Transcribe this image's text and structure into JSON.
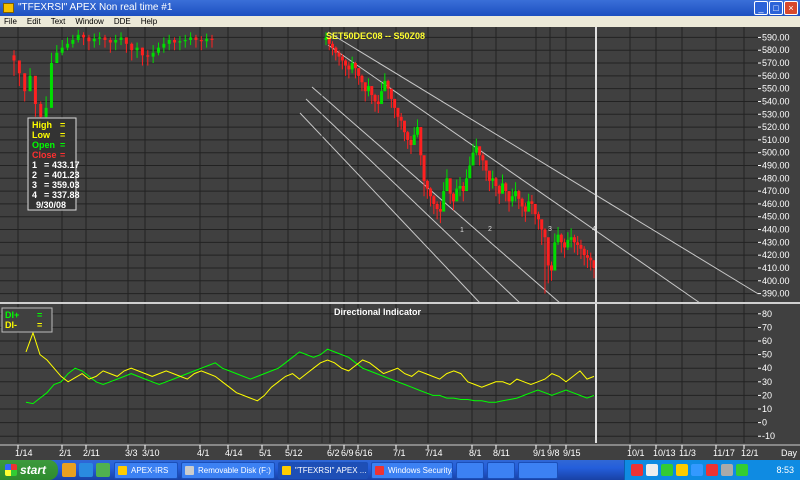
{
  "window": {
    "title": "\"TFEXRSI\" APEX Non real time #1",
    "menu": [
      "File",
      "Edit",
      "Text",
      "Window",
      "DDE",
      "Help"
    ]
  },
  "chart": {
    "symbol_label": "SET50DEC08 -- S50Z08",
    "price_ticks": [
      590,
      580,
      570,
      560,
      550,
      540,
      530,
      520,
      510,
      500,
      490,
      480,
      470,
      460,
      450,
      440,
      430,
      420,
      410,
      400,
      390
    ],
    "price_tick_labels": [
      "590.00",
      "580.00",
      "570.00",
      "560.00",
      "550.00",
      "540.00",
      "530.00",
      "520.00",
      "510.00",
      "500.00",
      "490.00",
      "480.00",
      "470.00",
      "460.00",
      "450.00",
      "440.00",
      "430.00",
      "420.00",
      "410.00",
      "400.00",
      "390.00"
    ],
    "info_box": {
      "rows": [
        {
          "label": "High",
          "eq": "=",
          "value": "",
          "color": "#ffff00"
        },
        {
          "label": "Low",
          "eq": "=",
          "value": "",
          "color": "#ffff00"
        },
        {
          "label": "Open",
          "eq": "=",
          "value": "",
          "color": "#00ff00"
        },
        {
          "label": "Close",
          "eq": "=",
          "value": "",
          "color": "#ff3030"
        },
        {
          "label": "1",
          "eq": "=",
          "value": "433.17",
          "color": "#ffffff"
        },
        {
          "label": "2",
          "eq": "=",
          "value": "401.23",
          "color": "#ffffff"
        },
        {
          "label": "3",
          "eq": "=",
          "value": "359.03",
          "color": "#ffffff"
        },
        {
          "label": "4",
          "eq": "=",
          "value": "337.88",
          "color": "#ffffff"
        }
      ],
      "date": "9/30/08"
    },
    "channel_labels": [
      "1",
      "2",
      "3",
      "4"
    ],
    "indicator": {
      "title": "Directional Indicator",
      "legend": [
        {
          "label": "DI+",
          "eq": "=",
          "color": "#00ff00"
        },
        {
          "label": "DI-",
          "eq": "=",
          "color": "#ffff00"
        }
      ],
      "ticks": [
        80,
        70,
        60,
        50,
        40,
        30,
        20,
        10,
        0,
        -10
      ],
      "tick_labels": [
        "80",
        "70",
        "60",
        "50",
        "40",
        "30",
        "20",
        "10",
        "0",
        "-10"
      ]
    },
    "date_labels": [
      "1/14",
      "2/1",
      "2/11",
      "3/3",
      "3/10",
      "4/1",
      "4/14",
      "5/1",
      "5/12",
      "6/2",
      "6/9",
      "6/16",
      "7/1",
      "7/14",
      "8/1",
      "8/11",
      "9/1",
      "9/8",
      "9/15",
      "10/1",
      "10/13",
      "11/3",
      "11/17",
      "12/1"
    ],
    "x_axis_unit": "Day"
  },
  "chart_data": [
    {
      "type": "candlestick",
      "title": "SET50DEC08 -- S50Z08",
      "ylim": [
        385,
        595
      ],
      "x": [
        "1/14",
        "1/16",
        "1/18",
        "1/22",
        "1/24",
        "1/28",
        "1/30",
        "2/1",
        "2/4",
        "2/6",
        "2/8",
        "2/11",
        "2/13",
        "2/15",
        "2/18",
        "2/20",
        "2/22",
        "2/25",
        "2/27",
        "2/29",
        "3/3",
        "3/5",
        "3/7",
        "3/10",
        "3/12",
        "3/14",
        "3/17",
        "3/19",
        "3/21",
        "3/24",
        "3/26",
        "3/28",
        "3/31",
        "4/1",
        "4/3",
        "4/7",
        "4/9",
        "4/11",
        "6/2",
        "6/3",
        "6/4",
        "6/5",
        "6/6",
        "6/9",
        "6/10",
        "6/11",
        "6/12",
        "6/13",
        "6/16",
        "6/17",
        "6/18",
        "6/19",
        "6/20",
        "6/23",
        "6/24",
        "6/25",
        "6/26",
        "6/27",
        "6/30",
        "7/1",
        "7/2",
        "7/3",
        "7/4",
        "7/7",
        "7/8",
        "7/9",
        "7/10",
        "7/11",
        "7/14",
        "7/15",
        "7/16",
        "7/18",
        "7/21",
        "7/22",
        "7/23",
        "7/24",
        "7/25",
        "7/28",
        "7/29",
        "7/30",
        "7/31",
        "8/1",
        "8/4",
        "8/5",
        "8/6",
        "8/7",
        "8/8",
        "8/11",
        "8/13",
        "8/14",
        "8/15",
        "8/18",
        "8/19",
        "8/20",
        "8/21",
        "8/22",
        "8/25",
        "8/26",
        "8/27",
        "8/28",
        "8/29",
        "9/1",
        "9/2",
        "9/3",
        "9/4",
        "9/5",
        "9/8",
        "9/9",
        "9/10",
        "9/11",
        "9/12",
        "9/15",
        "9/16",
        "9/17",
        "9/18",
        "9/19",
        "9/22",
        "9/23",
        "9/24",
        "9/25",
        "9/26",
        "9/29",
        "9/30"
      ],
      "close": [
        572,
        562,
        548,
        560,
        538,
        528,
        535,
        570,
        578,
        582,
        585,
        588,
        592,
        590,
        587,
        589,
        590,
        588,
        586,
        588,
        590,
        585,
        580,
        582,
        576,
        575,
        578,
        582,
        585,
        588,
        586,
        587,
        588,
        590,
        588,
        587,
        589,
        588,
        590,
        585,
        582,
        578,
        575,
        572,
        568,
        565,
        570,
        566,
        560,
        555,
        548,
        552,
        545,
        540,
        538,
        548,
        556,
        550,
        542,
        535,
        528,
        525,
        516,
        510,
        506,
        514,
        520,
        498,
        478,
        472,
        466,
        460,
        456,
        454,
        470,
        480,
        468,
        462,
        472,
        474,
        470,
        480,
        490,
        500,
        505,
        498,
        494,
        486,
        478,
        480,
        474,
        468,
        476,
        470,
        462,
        466,
        470,
        464,
        458,
        454,
        462,
        460,
        452,
        448,
        440,
        434,
        412,
        408,
        430,
        436,
        430,
        426,
        432,
        434,
        430,
        428,
        425,
        420,
        418,
        416,
        410
      ],
      "high": [
        580,
        572,
        562,
        566,
        548,
        540,
        544,
        578,
        584,
        588,
        590,
        592,
        596,
        594,
        592,
        593,
        594,
        592,
        590,
        592,
        594,
        590,
        586,
        586,
        582,
        580,
        584,
        586,
        590,
        592,
        590,
        591,
        592,
        594,
        592,
        591,
        593,
        592,
        594,
        590,
        587,
        583,
        580,
        577,
        573,
        571,
        575,
        571,
        566,
        561,
        554,
        558,
        552,
        546,
        545,
        555,
        562,
        557,
        549,
        542,
        535,
        531,
        523,
        517,
        513,
        520,
        526,
        505,
        486,
        479,
        473,
        467,
        462,
        462,
        477,
        487,
        475,
        469,
        479,
        481,
        477,
        487,
        497,
        507,
        511,
        505,
        500,
        493,
        485,
        486,
        481,
        475,
        483,
        477,
        469,
        472,
        477,
        471,
        465,
        461,
        468,
        467,
        459,
        454,
        447,
        441,
        420,
        415,
        437,
        442,
        437,
        433,
        438,
        441,
        436,
        435,
        432,
        427,
        424,
        422,
        416
      ],
      "low": [
        560,
        552,
        540,
        548,
        528,
        520,
        526,
        558,
        570,
        576,
        580,
        582,
        586,
        584,
        580,
        582,
        584,
        582,
        578,
        580,
        584,
        578,
        572,
        574,
        568,
        568,
        570,
        576,
        578,
        580,
        580,
        580,
        582,
        584,
        582,
        580,
        582,
        582,
        584,
        580,
        576,
        572,
        568,
        565,
        560,
        558,
        562,
        558,
        553,
        548,
        540,
        544,
        538,
        532,
        531,
        540,
        548,
        542,
        535,
        527,
        520,
        518,
        509,
        503,
        499,
        506,
        512,
        490,
        466,
        464,
        458,
        452,
        448,
        445,
        462,
        472,
        460,
        455,
        464,
        466,
        462,
        472,
        482,
        492,
        498,
        490,
        486,
        478,
        470,
        472,
        466,
        460,
        468,
        462,
        454,
        458,
        462,
        456,
        450,
        446,
        454,
        452,
        444,
        440,
        428,
        390,
        398,
        400,
        422,
        428,
        422,
        418,
        424,
        426,
        422,
        420,
        417,
        412,
        410,
        408,
        402
      ]
    },
    {
      "type": "line",
      "title": "Directional Indicator",
      "ylim": [
        -15,
        85
      ],
      "x_range": [
        "1/14",
        "9/30"
      ],
      "series": [
        {
          "name": "DI+",
          "color": "#00ff00",
          "values": [
            15,
            14,
            18,
            22,
            28,
            30,
            36,
            40,
            38,
            34,
            30,
            28,
            30,
            32,
            34,
            36,
            34,
            32,
            30,
            28,
            30,
            32,
            34,
            36,
            38,
            40,
            42,
            44,
            40,
            38,
            36,
            34,
            32,
            34,
            36,
            38,
            40,
            44,
            48,
            52,
            50,
            48,
            50,
            54,
            52,
            50,
            48,
            44,
            40,
            38,
            36,
            34,
            32,
            30,
            28,
            26,
            24,
            22,
            20,
            20,
            18,
            18,
            17,
            17,
            16,
            16,
            15,
            15,
            16,
            17,
            18,
            20,
            22,
            24,
            22,
            20,
            22,
            24,
            22,
            20,
            18,
            20
          ]
        },
        {
          "name": "DI-",
          "color": "#ffff00",
          "values": [
            52,
            66,
            50,
            46,
            40,
            34,
            30,
            33,
            36,
            32,
            34,
            38,
            36,
            34,
            38,
            40,
            38,
            36,
            34,
            36,
            38,
            36,
            34,
            32,
            36,
            38,
            36,
            34,
            30,
            26,
            22,
            20,
            18,
            16,
            20,
            26,
            30,
            34,
            36,
            32,
            36,
            40,
            44,
            46,
            44,
            40,
            38,
            42,
            46,
            44,
            40,
            36,
            38,
            40,
            36,
            34,
            38,
            36,
            34,
            32,
            36,
            38,
            36,
            30,
            28,
            26,
            28,
            30,
            30,
            28,
            32,
            30,
            28,
            30,
            32,
            36,
            34,
            30,
            34,
            38,
            32,
            34
          ]
        }
      ]
    }
  ]
}
